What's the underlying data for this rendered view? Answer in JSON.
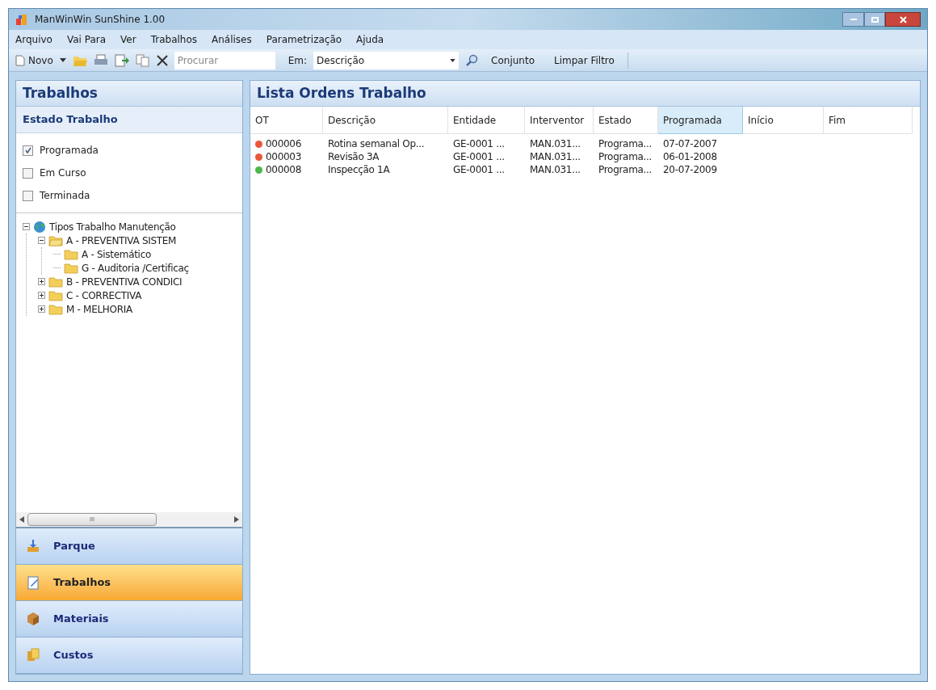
{
  "window": {
    "title": "ManWinWin SunShine 1.00"
  },
  "menu": [
    "Arquivo",
    "Vai Para",
    "Ver",
    "Trabalhos",
    "Análises",
    "Parametrização",
    "Ajuda"
  ],
  "toolbar": {
    "new_label": "Novo",
    "search_placeholder": "Procurar",
    "in_label": "Em:",
    "in_value": "Descrição",
    "buttons": [
      "Conjunto",
      "Limpar Filtro"
    ]
  },
  "left_panel": {
    "title": "Trabalhos",
    "section": "Estado Trabalho",
    "filters": [
      {
        "label": "Programada",
        "checked": true
      },
      {
        "label": "Em Curso",
        "checked": false
      },
      {
        "label": "Terminada",
        "checked": false
      }
    ],
    "tree": [
      {
        "label": "Tipos Trabalho Manutenção",
        "kind": "globe",
        "expanded": true,
        "children": [
          {
            "label": "A - PREVENTIVA SISTEM",
            "kind": "folder",
            "expanded": true,
            "children": [
              {
                "label": "A - Sistemático",
                "kind": "folder"
              },
              {
                "label": "G - Auditoria /Certificaç",
                "kind": "folder"
              }
            ]
          },
          {
            "label": "B - PREVENTIVA CONDICI",
            "kind": "folder",
            "expanded": false
          },
          {
            "label": "C - CORRECTIVA",
            "kind": "folder",
            "expanded": false
          },
          {
            "label": "M - MELHORIA",
            "kind": "folder",
            "expanded": false
          }
        ]
      }
    ],
    "scrollbar_grip": "III",
    "nav": [
      {
        "label": "Parque",
        "kind": "parque",
        "selected": false
      },
      {
        "label": "Trabalhos",
        "kind": "trabalhos",
        "selected": true
      },
      {
        "label": "Materiais",
        "kind": "materiais",
        "selected": false
      },
      {
        "label": "Custos",
        "kind": "custos",
        "selected": false
      }
    ]
  },
  "list": {
    "title": "Lista Ordens Trabalho",
    "columns": [
      {
        "label": "OT",
        "selected": false
      },
      {
        "label": "Descrição",
        "selected": false
      },
      {
        "label": "Entidade",
        "selected": false
      },
      {
        "label": "Interventor",
        "selected": false
      },
      {
        "label": "Estado",
        "selected": false
      },
      {
        "label": "Programada",
        "selected": true
      },
      {
        "label": "Início",
        "selected": false
      },
      {
        "label": "Fim",
        "selected": false
      }
    ],
    "rows": [
      {
        "color": "#e8573a",
        "cells": [
          "000006",
          "Rotina semanal Op...",
          "GE-0001 ...",
          "MAN.031...",
          "Programa...",
          "07-07-2007"
        ]
      },
      {
        "color": "#e8573a",
        "cells": [
          "000003",
          "Revisão 3A",
          "GE-0001 ...",
          "MAN.031...",
          "Programa...",
          "06-01-2008"
        ]
      },
      {
        "color": "#4cb84a",
        "cells": [
          "000008",
          "Inspecção 1A",
          "GE-0001 ...",
          "MAN.031...",
          "Programa...",
          "20-07-2009"
        ]
      }
    ]
  }
}
